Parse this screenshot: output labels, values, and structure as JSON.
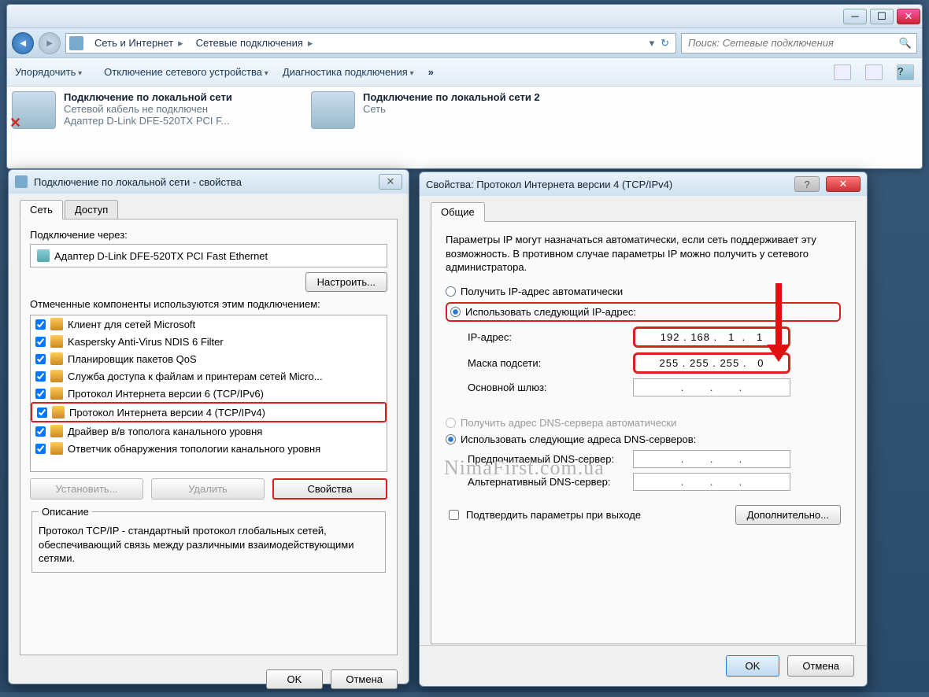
{
  "explorer": {
    "breadcrumb": [
      "Сеть и Интернет",
      "Сетевые подключения"
    ],
    "search_placeholder": "Поиск: Сетевые подключения",
    "toolbar": {
      "organize": "Упорядочить",
      "disable": "Отключение сетевого устройства",
      "diag": "Диагностика подключения",
      "more": "»"
    },
    "connections": [
      {
        "title": "Подключение по локальной сети",
        "line2": "Сетевой кабель не подключен",
        "line3": "Адаптер D-Link DFE-520TX PCI F...",
        "off": true
      },
      {
        "title": "Подключение по локальной сети 2",
        "line2": "Сеть",
        "line3": "",
        "off": false
      }
    ]
  },
  "props": {
    "title": "Подключение по локальной сети - свойства",
    "tabs": {
      "net": "Сеть",
      "access": "Доступ"
    },
    "conn_via": "Подключение через:",
    "adapter": "Адаптер D-Link DFE-520TX PCI Fast Ethernet",
    "configure": "Настроить...",
    "components_label": "Отмеченные компоненты используются этим подключением:",
    "components": [
      "Клиент для сетей Microsoft",
      "Kaspersky Anti-Virus NDIS 6 Filter",
      "Планировщик пакетов QoS",
      "Служба доступа к файлам и принтерам сетей Micro...",
      "Протокол Интернета версии 6 (TCP/IPv6)",
      "Протокол Интернета версии 4 (TCP/IPv4)",
      "Драйвер в/в тополога канального уровня",
      "Ответчик обнаружения топологии канального уровня"
    ],
    "highlight_index": 5,
    "install": "Установить...",
    "remove": "Удалить",
    "properties": "Свойства",
    "desc_title": "Описание",
    "desc_text": "Протокол TCP/IP - стандартный протокол глобальных сетей, обеспечивающий связь между различными взаимодействующими сетями.",
    "ok": "OK",
    "cancel": "Отмена"
  },
  "ip": {
    "title": "Свойства: Протокол Интернета версии 4 (TCP/IPv4)",
    "tab": "Общие",
    "intro": "Параметры IP могут назначаться автоматически, если сеть поддерживает эту возможность. В противном случае параметры IP можно получить у сетевого администратора.",
    "radio_auto_ip": "Получить IP-адрес автоматически",
    "radio_static_ip": "Использовать следующий IP-адрес:",
    "ipaddr_label": "IP-адрес:",
    "ipaddr": "192 . 168 .   1  .   1",
    "mask_label": "Маска подсети:",
    "mask": "255 . 255 . 255 .   0",
    "gw_label": "Основной шлюз:",
    "gw": ".       .       .",
    "radio_auto_dns": "Получить адрес DNS-сервера автоматически",
    "radio_static_dns": "Использовать следующие адреса DNS-серверов:",
    "dns1_label": "Предпочитаемый DNS-сервер:",
    "dns1": ".       .       .",
    "dns2_label": "Альтернативный DNS-сервер:",
    "dns2": ".       .       .",
    "confirm_exit": "Подтвердить параметры при выходе",
    "advanced": "Дополнительно...",
    "ok": "OK",
    "cancel": "Отмена"
  },
  "watermark": "NimaFirst.com.ua"
}
